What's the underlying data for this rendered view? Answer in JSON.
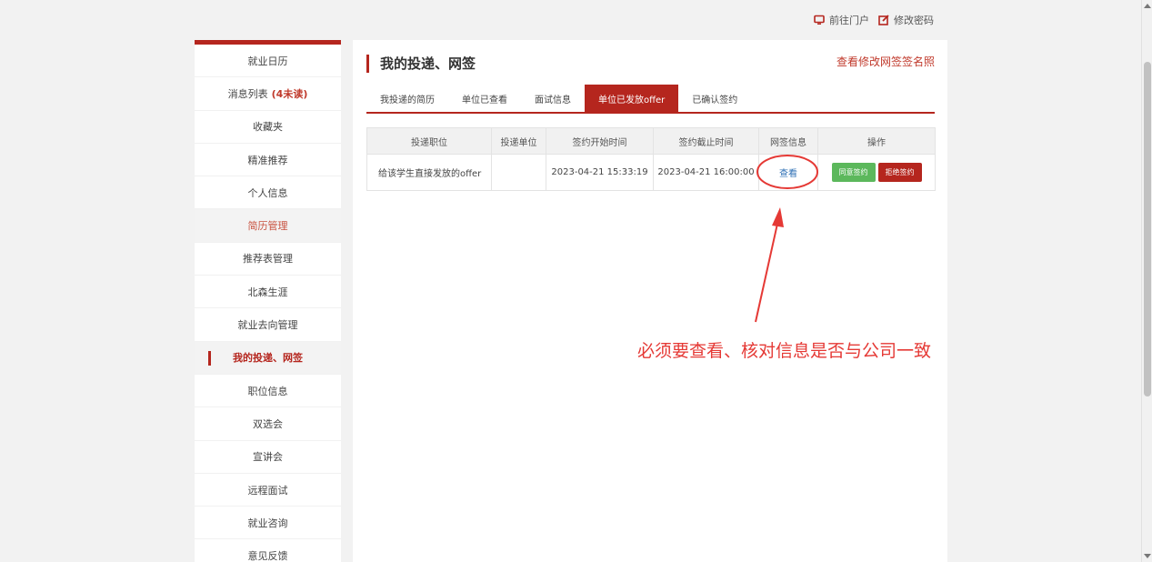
{
  "header": {
    "portal_link": "前往门户",
    "password_link": "修改密码"
  },
  "sidebar": {
    "items": [
      {
        "label": "就业日历"
      },
      {
        "label": "消息列表",
        "badge": "(4未读)"
      },
      {
        "label": "收藏夹"
      },
      {
        "label": "精准推荐"
      },
      {
        "label": "个人信息"
      },
      {
        "label": "简历管理"
      },
      {
        "label": "推荐表管理"
      },
      {
        "label": "北森生涯"
      },
      {
        "label": "就业去向管理"
      },
      {
        "label": "我的投递、网签"
      },
      {
        "label": "职位信息"
      },
      {
        "label": "双选会"
      },
      {
        "label": "宣讲会"
      },
      {
        "label": "远程面试"
      },
      {
        "label": "就业咨询"
      },
      {
        "label": "意见反馈"
      }
    ]
  },
  "main": {
    "title": "我的投递、网签",
    "view_sign_link": "查看修改网签签名照",
    "tabs": [
      {
        "label": "我投递的简历"
      },
      {
        "label": "单位已查看"
      },
      {
        "label": "面试信息"
      },
      {
        "label": "单位已发放offer"
      },
      {
        "label": "已确认签约"
      }
    ],
    "table": {
      "headers": [
        "投递职位",
        "投递单位",
        "签约开始时间",
        "签约截止时间",
        "网签信息",
        "操作"
      ],
      "rows": [
        {
          "position": "给该学生直接发放的offer",
          "company": "",
          "start": "2023-04-21 15:33:19",
          "end": "2023-04-21 16:00:00",
          "view": "查看",
          "agree": "同意签约",
          "reject": "拒绝签约"
        }
      ]
    }
  },
  "annotation": {
    "text": "必须要查看、核对信息是否与公司一致"
  },
  "colors": {
    "accent": "#b5261e",
    "agree": "#5cb85c",
    "link": "#2d6fb4",
    "annotation": "#e53935"
  },
  "icons": {
    "portal": "monitor-icon",
    "password": "edit-icon"
  }
}
